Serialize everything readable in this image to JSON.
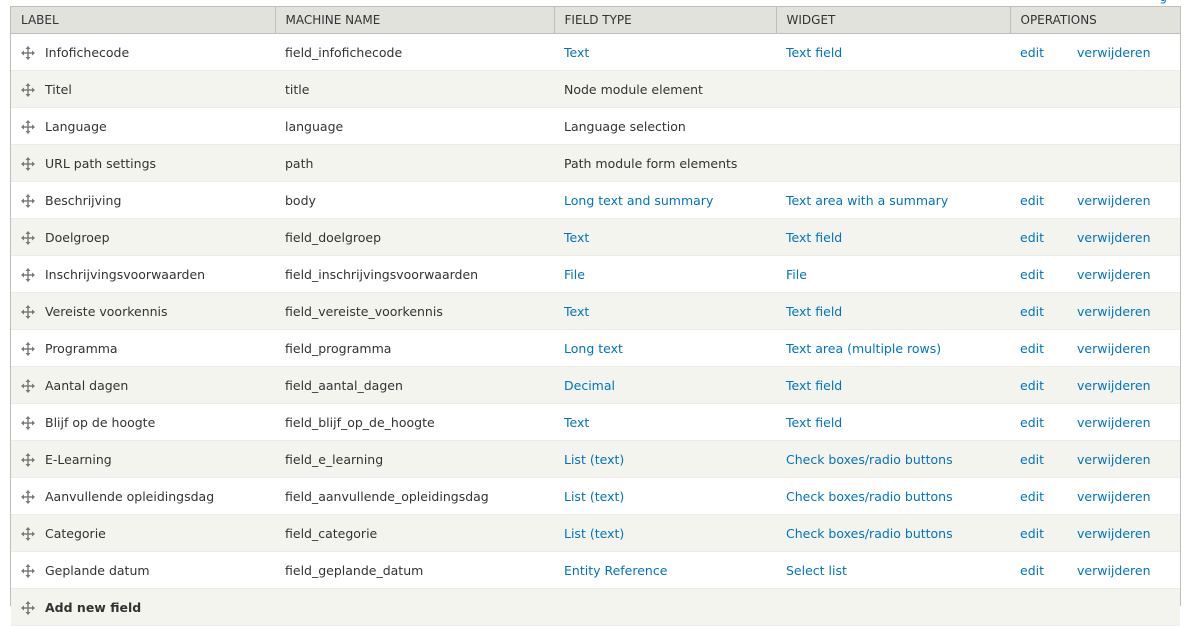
{
  "corner_link": "g",
  "header": {
    "label": "LABEL",
    "machine_name": "MACHINE NAME",
    "field_type": "FIELD TYPE",
    "widget": "WIDGET",
    "operations": "OPERATIONS"
  },
  "rows": [
    {
      "label": "Infofichecode",
      "machine": "field_infofichecode",
      "type": "Text",
      "type_link": true,
      "widget": "Text field",
      "edit": "edit",
      "delete": "verwijderen"
    },
    {
      "label": "Titel",
      "machine": "title",
      "type": "Node module element",
      "type_link": false,
      "widget": "",
      "edit": "",
      "delete": ""
    },
    {
      "label": "Language",
      "machine": "language",
      "type": "Language selection",
      "type_link": false,
      "widget": "",
      "edit": "",
      "delete": ""
    },
    {
      "label": "URL path settings",
      "machine": "path",
      "type": "Path module form elements",
      "type_link": false,
      "widget": "",
      "edit": "",
      "delete": ""
    },
    {
      "label": "Beschrijving",
      "machine": "body",
      "type": "Long text and summary",
      "type_link": true,
      "widget": "Text area with a summary",
      "edit": "edit",
      "delete": "verwijderen"
    },
    {
      "label": "Doelgroep",
      "machine": "field_doelgroep",
      "type": "Text",
      "type_link": true,
      "widget": "Text field",
      "edit": "edit",
      "delete": "verwijderen"
    },
    {
      "label": "Inschrijvingsvoorwaarden",
      "machine": "field_inschrijvingsvoorwaarden",
      "type": "File",
      "type_link": true,
      "widget": "File",
      "edit": "edit",
      "delete": "verwijderen"
    },
    {
      "label": "Vereiste voorkennis",
      "machine": "field_vereiste_voorkennis",
      "type": "Text",
      "type_link": true,
      "widget": "Text field",
      "edit": "edit",
      "delete": "verwijderen"
    },
    {
      "label": "Programma",
      "machine": "field_programma",
      "type": "Long text",
      "type_link": true,
      "widget": "Text area (multiple rows)",
      "edit": "edit",
      "delete": "verwijderen"
    },
    {
      "label": "Aantal dagen",
      "machine": "field_aantal_dagen",
      "type": "Decimal",
      "type_link": true,
      "widget": "Text field",
      "edit": "edit",
      "delete": "verwijderen"
    },
    {
      "label": "Blijf op de hoogte",
      "machine": "field_blijf_op_de_hoogte",
      "type": "Text",
      "type_link": true,
      "widget": "Text field",
      "edit": "edit",
      "delete": "verwijderen"
    },
    {
      "label": "E-Learning",
      "machine": "field_e_learning",
      "type": "List (text)",
      "type_link": true,
      "widget": "Check boxes/radio buttons",
      "edit": "edit",
      "delete": "verwijderen"
    },
    {
      "label": "Aanvullende opleidingsdag",
      "machine": "field_aanvullende_opleidingsdag",
      "type": "List (text)",
      "type_link": true,
      "widget": "Check boxes/radio buttons",
      "edit": "edit",
      "delete": "verwijderen"
    },
    {
      "label": "Categorie",
      "machine": "field_categorie",
      "type": "List (text)",
      "type_link": true,
      "widget": "Check boxes/radio buttons",
      "edit": "edit",
      "delete": "verwijderen"
    },
    {
      "label": "Geplande datum",
      "machine": "field_geplande_datum",
      "type": "Entity Reference",
      "type_link": true,
      "widget": "Select list",
      "edit": "edit",
      "delete": "verwijderen"
    }
  ],
  "add_row": {
    "label": "Add new field"
  }
}
